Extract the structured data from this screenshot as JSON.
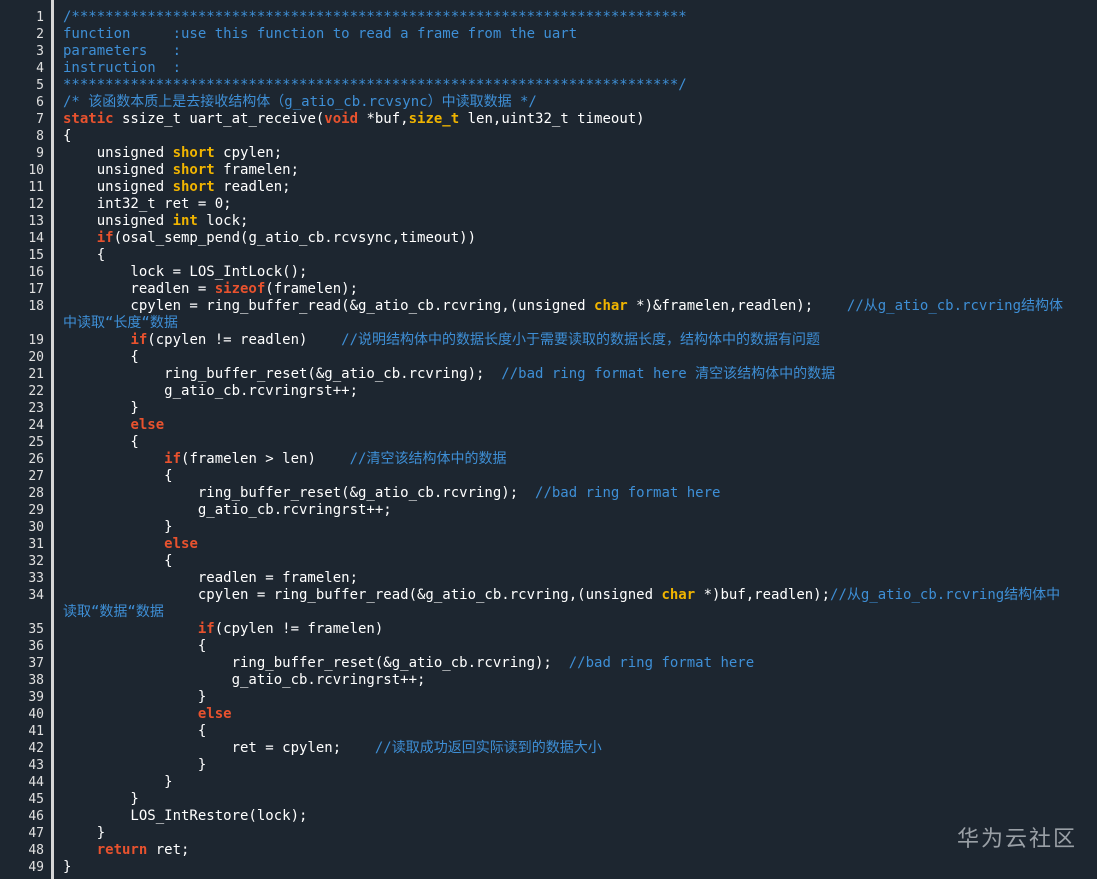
{
  "colors": {
    "background": "#1d2630",
    "comment": "#3e8fd6",
    "keyword": "#e8522e",
    "type": "#f0b400",
    "text": "#ffffff"
  },
  "watermark": "华为云社区",
  "lines": [
    {
      "n": "1",
      "parts": [
        [
          "c",
          "/*************************************************************************"
        ]
      ]
    },
    {
      "n": "2",
      "parts": [
        [
          "c",
          "function     :use this function to read a frame from the uart"
        ]
      ]
    },
    {
      "n": "3",
      "parts": [
        [
          "c",
          "parameters   :"
        ]
      ]
    },
    {
      "n": "4",
      "parts": [
        [
          "c",
          "instruction  :"
        ]
      ]
    },
    {
      "n": "5",
      "parts": [
        [
          "c",
          "*************************************************************************/"
        ]
      ]
    },
    {
      "n": "6",
      "parts": [
        [
          "c",
          "/* 该函数本质上是去接收结构体（g_atio_cb.rcvsync）中读取数据 */"
        ]
      ]
    },
    {
      "n": "7",
      "parts": [
        [
          "k",
          "static"
        ],
        [
          "w",
          " ssize_t uart_at_receive("
        ],
        [
          "k",
          "void"
        ],
        [
          "w",
          " *buf,"
        ],
        [
          "y",
          "size_t"
        ],
        [
          "w",
          " len,uint32_t timeout)"
        ]
      ]
    },
    {
      "n": "8",
      "parts": [
        [
          "w",
          "{"
        ]
      ]
    },
    {
      "n": "9",
      "parts": [
        [
          "w",
          "    unsigned "
        ],
        [
          "y",
          "short"
        ],
        [
          "w",
          " cpylen;"
        ]
      ]
    },
    {
      "n": "10",
      "parts": [
        [
          "w",
          "    unsigned "
        ],
        [
          "y",
          "short"
        ],
        [
          "w",
          " framelen;"
        ]
      ]
    },
    {
      "n": "11",
      "parts": [
        [
          "w",
          "    unsigned "
        ],
        [
          "y",
          "short"
        ],
        [
          "w",
          " readlen;"
        ]
      ]
    },
    {
      "n": "12",
      "parts": [
        [
          "w",
          "    int32_t ret = 0;"
        ]
      ]
    },
    {
      "n": "13",
      "parts": [
        [
          "w",
          "    unsigned "
        ],
        [
          "y",
          "int"
        ],
        [
          "w",
          " lock;"
        ]
      ]
    },
    {
      "n": "14",
      "parts": [
        [
          "w",
          "    "
        ],
        [
          "k",
          "if"
        ],
        [
          "w",
          "(osal_semp_pend(g_atio_cb.rcvsync,timeout))"
        ]
      ]
    },
    {
      "n": "15",
      "parts": [
        [
          "w",
          "    {"
        ]
      ]
    },
    {
      "n": "16",
      "parts": [
        [
          "w",
          "        lock = LOS_IntLock();"
        ]
      ]
    },
    {
      "n": "17",
      "parts": [
        [
          "w",
          "        readlen = "
        ],
        [
          "k",
          "sizeof"
        ],
        [
          "w",
          "(framelen);"
        ]
      ]
    },
    {
      "n": "18",
      "tall": true,
      "parts": [
        [
          "w",
          "        cpylen = ring_buffer_read(&g_atio_cb.rcvring,(unsigned "
        ],
        [
          "y",
          "char"
        ],
        [
          "w",
          " *)&framelen,readlen);    "
        ],
        [
          "c",
          "//从g_atio_cb.rcvring结构体"
        ]
      ],
      "wrap": [
        [
          "c",
          "中读取“长度“数据"
        ]
      ]
    },
    {
      "n": "19",
      "parts": [
        [
          "w",
          "        "
        ],
        [
          "k",
          "if"
        ],
        [
          "w",
          "(cpylen != readlen)    "
        ],
        [
          "c",
          "//说明结构体中的数据长度小于需要读取的数据长度，结构体中的数据有问题"
        ]
      ]
    },
    {
      "n": "20",
      "parts": [
        [
          "w",
          "        {"
        ]
      ]
    },
    {
      "n": "21",
      "parts": [
        [
          "w",
          "            ring_buffer_reset(&g_atio_cb.rcvring);  "
        ],
        [
          "c",
          "//bad ring format here 清空该结构体中的数据"
        ]
      ]
    },
    {
      "n": "22",
      "parts": [
        [
          "w",
          "            g_atio_cb.rcvringrst++;"
        ]
      ]
    },
    {
      "n": "23",
      "parts": [
        [
          "w",
          "        }"
        ]
      ]
    },
    {
      "n": "24",
      "parts": [
        [
          "w",
          "        "
        ],
        [
          "k",
          "else"
        ]
      ]
    },
    {
      "n": "25",
      "parts": [
        [
          "w",
          "        {"
        ]
      ]
    },
    {
      "n": "26",
      "parts": [
        [
          "w",
          "            "
        ],
        [
          "k",
          "if"
        ],
        [
          "w",
          "(framelen > len)    "
        ],
        [
          "c",
          "//清空该结构体中的数据"
        ]
      ]
    },
    {
      "n": "27",
      "parts": [
        [
          "w",
          "            {"
        ]
      ]
    },
    {
      "n": "28",
      "parts": [
        [
          "w",
          "                ring_buffer_reset(&g_atio_cb.rcvring);  "
        ],
        [
          "c",
          "//bad ring format here"
        ]
      ]
    },
    {
      "n": "29",
      "parts": [
        [
          "w",
          "                g_atio_cb.rcvringrst++;"
        ]
      ]
    },
    {
      "n": "30",
      "parts": [
        [
          "w",
          "            }"
        ]
      ]
    },
    {
      "n": "31",
      "parts": [
        [
          "w",
          "            "
        ],
        [
          "k",
          "else"
        ]
      ]
    },
    {
      "n": "32",
      "parts": [
        [
          "w",
          "            {"
        ]
      ]
    },
    {
      "n": "33",
      "parts": [
        [
          "w",
          "                readlen = framelen;"
        ]
      ]
    },
    {
      "n": "34",
      "tall": true,
      "parts": [
        [
          "w",
          "                cpylen = ring_buffer_read(&g_atio_cb.rcvring,(unsigned "
        ],
        [
          "y",
          "char"
        ],
        [
          "w",
          " *)buf,readlen);"
        ],
        [
          "c",
          "//从g_atio_cb.rcvring结构体中"
        ]
      ],
      "wrap": [
        [
          "c",
          "读取“数据“数据"
        ]
      ]
    },
    {
      "n": "35",
      "parts": [
        [
          "w",
          "                "
        ],
        [
          "k",
          "if"
        ],
        [
          "w",
          "(cpylen != framelen)"
        ]
      ]
    },
    {
      "n": "36",
      "parts": [
        [
          "w",
          "                {"
        ]
      ]
    },
    {
      "n": "37",
      "parts": [
        [
          "w",
          "                    ring_buffer_reset(&g_atio_cb.rcvring);  "
        ],
        [
          "c",
          "//bad ring format here"
        ]
      ]
    },
    {
      "n": "38",
      "parts": [
        [
          "w",
          "                    g_atio_cb.rcvringrst++;"
        ]
      ]
    },
    {
      "n": "39",
      "parts": [
        [
          "w",
          "                }"
        ]
      ]
    },
    {
      "n": "40",
      "parts": [
        [
          "w",
          "                "
        ],
        [
          "k",
          "else"
        ]
      ]
    },
    {
      "n": "41",
      "parts": [
        [
          "w",
          "                {"
        ]
      ]
    },
    {
      "n": "42",
      "parts": [
        [
          "w",
          "                    ret = cpylen;    "
        ],
        [
          "c",
          "//读取成功返回实际读到的数据大小"
        ]
      ]
    },
    {
      "n": "43",
      "parts": [
        [
          "w",
          "                }"
        ]
      ]
    },
    {
      "n": "44",
      "parts": [
        [
          "w",
          "            }"
        ]
      ]
    },
    {
      "n": "45",
      "parts": [
        [
          "w",
          "        }"
        ]
      ]
    },
    {
      "n": "46",
      "parts": [
        [
          "w",
          "        LOS_IntRestore(lock);"
        ]
      ]
    },
    {
      "n": "47",
      "parts": [
        [
          "w",
          "    }"
        ]
      ]
    },
    {
      "n": "48",
      "parts": [
        [
          "w",
          "    "
        ],
        [
          "k",
          "return"
        ],
        [
          "w",
          " ret;"
        ]
      ]
    },
    {
      "n": "49",
      "parts": [
        [
          "w",
          "}"
        ]
      ]
    }
  ]
}
